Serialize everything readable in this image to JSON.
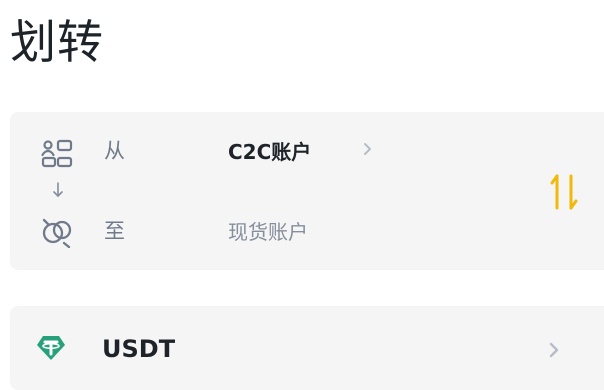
{
  "page": {
    "title": "划转"
  },
  "transfer": {
    "from_label": "从",
    "from_account": "C2C账户",
    "to_label": "至",
    "to_account": "现货账户",
    "icons": {
      "from": "account-from-icon",
      "direction": "arrow-down-icon",
      "to": "account-to-icon",
      "swap": "swap-icon",
      "chevron": "chevron-right-icon"
    }
  },
  "coin": {
    "name": "USDT",
    "icon": "usdt-icon",
    "chevron_icon": "chevron-right-icon"
  },
  "colors": {
    "primary_text": "#1e2329",
    "secondary_text": "#707a8a",
    "accent_yellow": "#f0b90b",
    "usdt_green": "#26a17b",
    "card_bg": "#f5f5f5"
  }
}
